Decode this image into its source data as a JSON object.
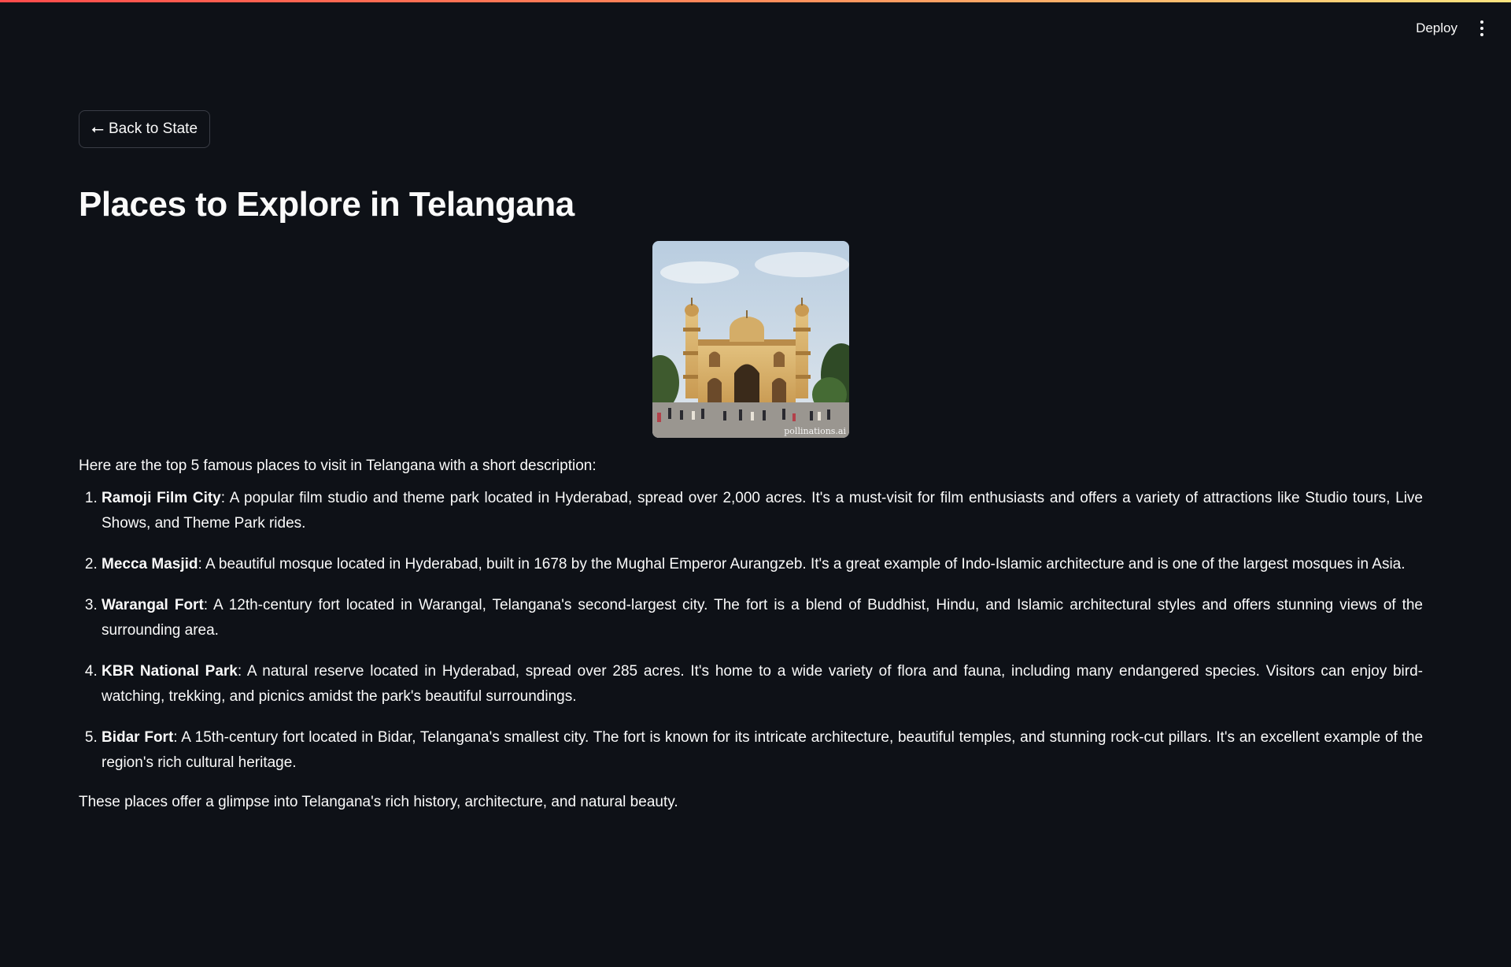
{
  "header": {
    "deploy_label": "Deploy",
    "menu_icon": "kebab-menu-icon"
  },
  "colors": {
    "background": "#0e1117",
    "text": "#fafafa",
    "accent_gradient_start": "#ff4b4b",
    "accent_gradient_end": "#fde47f"
  },
  "main": {
    "back_button": {
      "icon": "arrow-left-icon",
      "label": "Back to State"
    },
    "title": "Places to Explore in Telangana",
    "image": {
      "subject": "Mecca Masjid Hyderabad",
      "watermark": "pollinations.ai"
    },
    "intro": "Here are the top 5 famous places to visit in Telangana with a short description:",
    "places": [
      {
        "name": "Ramoji Film City",
        "description": ": A popular film studio and theme park located in Hyderabad, spread over 2,000 acres. It's a must-visit for film enthusiasts and offers a variety of attractions like Studio tours, Live Shows, and Theme Park rides."
      },
      {
        "name": "Mecca Masjid",
        "description": ": A beautiful mosque located in Hyderabad, built in 1678 by the Mughal Emperor Aurangzeb. It's a great example of Indo-Islamic architecture and is one of the largest mosques in Asia."
      },
      {
        "name": "Warangal Fort",
        "description": ": A 12th-century fort located in Warangal, Telangana's second-largest city. The fort is a blend of Buddhist, Hindu, and Islamic architectural styles and offers stunning views of the surrounding area."
      },
      {
        "name": "KBR National Park",
        "description": ": A natural reserve located in Hyderabad, spread over 285 acres. It's home to a wide variety of flora and fauna, including many endangered species. Visitors can enjoy bird-watching, trekking, and picnics amidst the park's beautiful surroundings."
      },
      {
        "name": "Bidar Fort",
        "description": ": A 15th-century fort located in Bidar, Telangana's smallest city. The fort is known for its intricate architecture, beautiful temples, and stunning rock-cut pillars. It's an excellent example of the region's rich cultural heritage."
      }
    ],
    "outro": "These places offer a glimpse into Telangana's rich history, architecture, and natural beauty."
  }
}
